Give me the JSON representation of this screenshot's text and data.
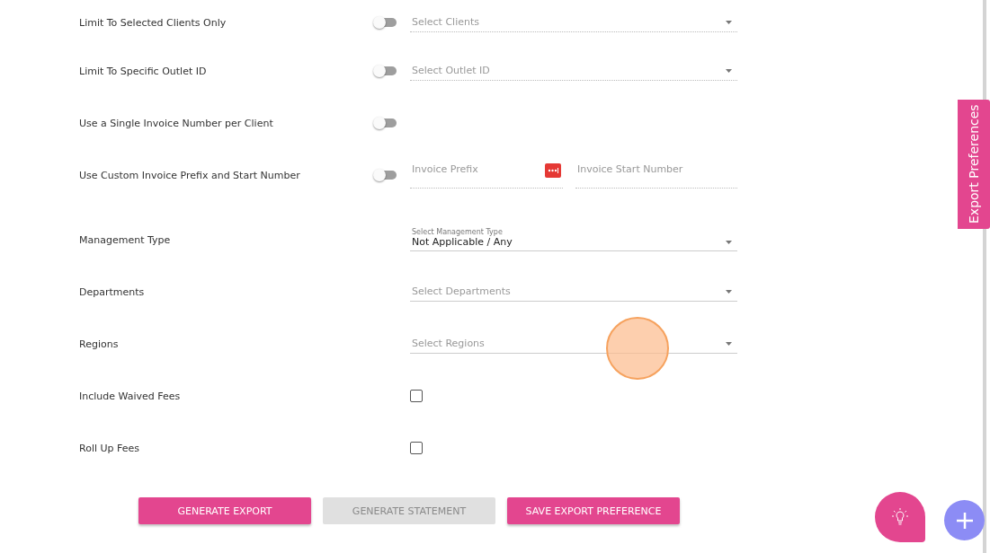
{
  "rows": [
    {
      "kind": "toggle-select",
      "label": "Limit To Selected Clients Only",
      "on": false,
      "placeholder": "Select Clients"
    },
    {
      "kind": "toggle-select",
      "label": "Limit To Specific Outlet ID",
      "on": false,
      "placeholder": "Select Outlet ID"
    },
    {
      "kind": "toggle",
      "label": "Use a Single Invoice Number per Client",
      "on": false
    },
    {
      "kind": "toggle-inputs",
      "label": "Use Custom Invoice Prefix and Start Number",
      "on": false,
      "placeholder": "Invoice Prefix",
      "placeholder_2": "Invoice Start Number"
    },
    {
      "kind": "labeled-select",
      "label": "Management Type",
      "field_label": "Select Management Type",
      "value": "Not Applicable / Any"
    },
    {
      "kind": "select",
      "label": "Departments",
      "placeholder": "Select Departments"
    },
    {
      "kind": "select",
      "label": "Regions",
      "placeholder": "Select Regions"
    },
    {
      "kind": "checkbox",
      "label": "Include Waived Fees",
      "checked": false
    },
    {
      "kind": "checkbox",
      "label": "Roll Up Fees",
      "checked": false
    }
  ],
  "buttons": [
    {
      "label": "GENERATE EXPORT",
      "disabled": false
    },
    {
      "label": "GENERATE STATEMENT",
      "disabled": true
    },
    {
      "label": "SAVE EXPORT PREFERENCE",
      "disabled": false
    }
  ],
  "side_tab": {
    "label": "Export Preferences"
  }
}
